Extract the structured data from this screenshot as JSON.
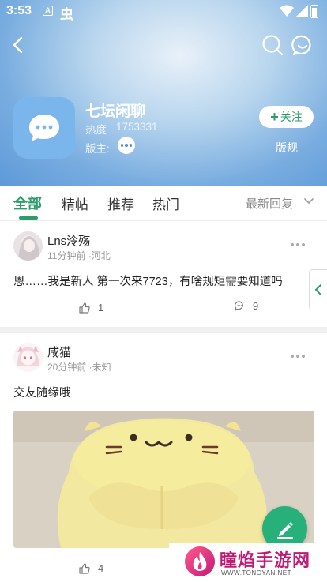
{
  "status_bar": {
    "time": "3:53",
    "notification_letter": "A",
    "app_glyph": "虫"
  },
  "forum": {
    "name": "七坛闲聊",
    "heat_label": "热度",
    "heat_value": "1753331",
    "moderator_label": "版主:",
    "follow_label": "关注",
    "rules_label": "版规"
  },
  "tabs": {
    "items": [
      {
        "label": "全部",
        "active": true
      },
      {
        "label": "精帖",
        "active": false
      },
      {
        "label": "推荐",
        "active": false
      },
      {
        "label": "热门",
        "active": false
      }
    ],
    "sort_label": "最新回复"
  },
  "posts": [
    {
      "author": "Lns泠殇",
      "meta": "11分钟前 ·河北",
      "text": "恩……我是新人 第一次来7723，有啥规矩需要知道吗",
      "likes": "1",
      "comments": "9"
    },
    {
      "author": "咸猫",
      "meta": "20分钟前 ·未知",
      "text": "交友随缘哦",
      "likes": "4",
      "image_icon": "cat-plush-photo"
    }
  ],
  "watermark": {
    "name": "瞳焰手游网",
    "url": "WWW.TONGYAN.NET"
  },
  "colors": {
    "accent": "#2a9d6b",
    "header_blue": "#79ade0",
    "fab": "#27b07a"
  },
  "icons": [
    "back-arrow-icon",
    "search-icon",
    "message-icon",
    "chat-bubble-icon",
    "more-dots-icon",
    "chevron-down-icon",
    "like-icon",
    "comment-icon",
    "chevron-left-icon",
    "pen-icon"
  ]
}
